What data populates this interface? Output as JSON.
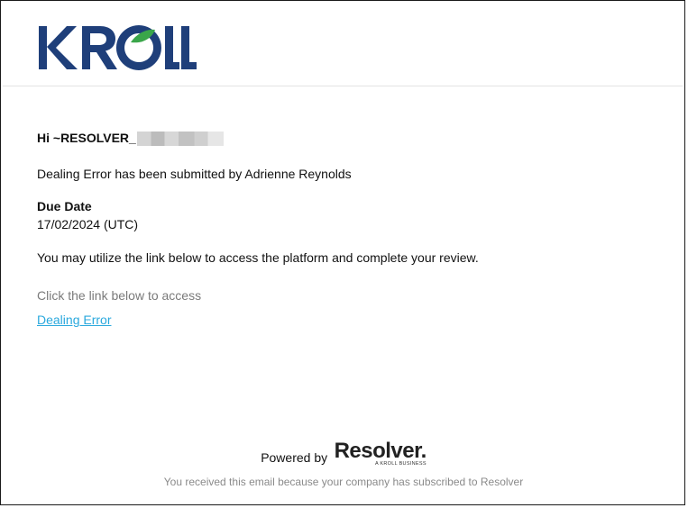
{
  "brand": {
    "logo_text": "KROLL",
    "primary_color": "#1f3f7a",
    "accent_color": "#3aa64a"
  },
  "email": {
    "greeting": "Hi ~RESOLVER_",
    "submitted_line": "Dealing Error has been submitted by Adrienne Reynolds",
    "due_date_label": "Due Date",
    "due_date_value": "17/02/2024 (UTC)",
    "instructions": "You may utilize the link below to access the platform and complete your review.",
    "click_text": "Click the link below to access",
    "link_label": "Dealing Error",
    "link_color": "#29a8dd"
  },
  "footer": {
    "powered_by": "Powered by",
    "resolver_logo": "Resolver.",
    "resolver_tagline": "A KROLL BUSINESS",
    "disclaimer": "You received this email because your company has subscribed to Resolver"
  }
}
